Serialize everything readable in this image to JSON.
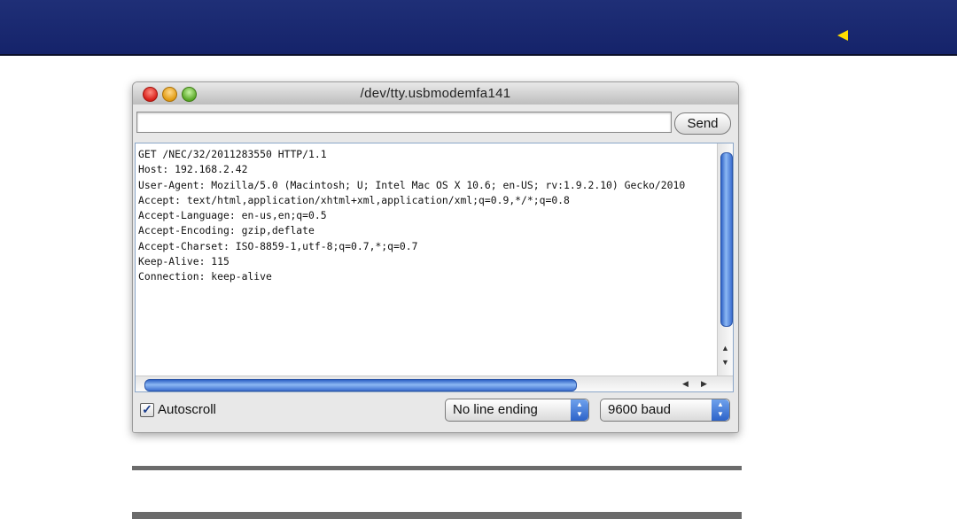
{
  "colors": {
    "banner": "#1a2a72",
    "arrow": "#ffdd00",
    "divider": "#6b6b6b"
  },
  "nav": {
    "back_icon": "left-triangle-icon"
  },
  "window": {
    "title": "/dev/tty.usbmodemfa141",
    "send_label": "Send",
    "input_value": "",
    "output_lines": [
      "GET /NEC/32/2011283550 HTTP/1.1",
      "Host: 192.168.2.42",
      "User-Agent: Mozilla/5.0 (Macintosh; U; Intel Mac OS X 10.6; en-US; rv:1.9.2.10) Gecko/2010",
      "Accept: text/html,application/xhtml+xml,application/xml;q=0.9,*/*;q=0.8",
      "Accept-Language: en-us,en;q=0.5",
      "Accept-Encoding: gzip,deflate",
      "Accept-Charset: ISO-8859-1,utf-8;q=0.7,*;q=0.7",
      "Keep-Alive: 115",
      "Connection: keep-alive"
    ],
    "autoscroll_label": "Autoscroll",
    "autoscroll_checked": true,
    "line_ending": "No line ending",
    "baud": "9600 baud"
  }
}
